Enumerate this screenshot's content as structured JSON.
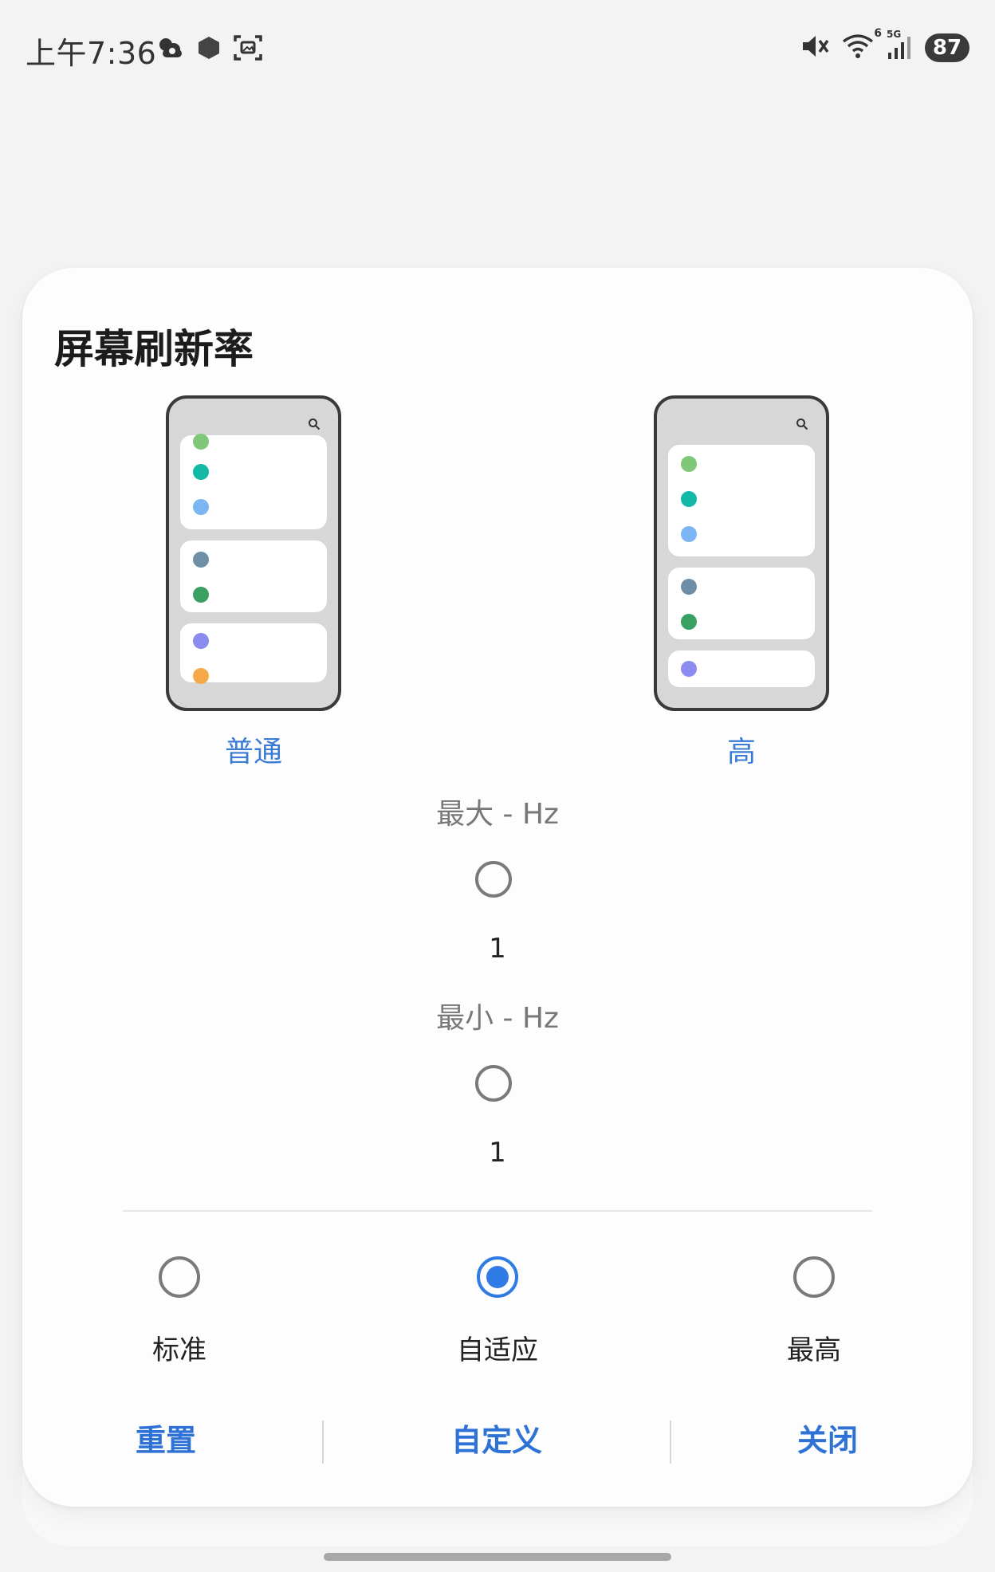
{
  "status_bar": {
    "time": "上午7:36",
    "battery": "87",
    "network": "5G",
    "wifi_badge": "6",
    "icons": [
      "weather-icon",
      "vpn-hex-icon",
      "screenshot-icon",
      "mute-icon",
      "wifi-icon",
      "signal-icon"
    ]
  },
  "dialog": {
    "title": "屏幕刷新率",
    "previews": [
      {
        "label": "普通"
      },
      {
        "label": "高"
      }
    ],
    "max_hz": {
      "label": "最大 - Hz",
      "value": "1"
    },
    "min_hz": {
      "label": "最小 - Hz",
      "value": "1"
    },
    "modes": [
      {
        "label": "标准",
        "selected": false
      },
      {
        "label": "自适应",
        "selected": true
      },
      {
        "label": "最高",
        "selected": false
      }
    ],
    "actions": {
      "reset": "重置",
      "custom": "自定义",
      "close": "关闭"
    }
  },
  "colors": {
    "accent": "#2f7ae5",
    "dots_normal": [
      "#7fc87a",
      "#14b8a6",
      "#7cb6f2",
      "#6f8fa6",
      "#3aa062",
      "#8b8bf0",
      "#f7a94a"
    ],
    "dots_high": [
      "#7fc87a",
      "#14b8a6",
      "#7cb6f2",
      "#6f8fa6",
      "#3aa062",
      "#8b8bf0"
    ]
  }
}
